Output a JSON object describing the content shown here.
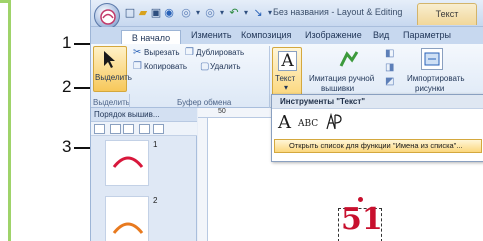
{
  "window": {
    "title": "Без названия - Layout & Editing",
    "context_tab": "Текст"
  },
  "tabs": [
    "В начало",
    "Изменить",
    "Композиция",
    "Изображение",
    "Вид",
    "Параметры"
  ],
  "clipboard": {
    "select_label": "Выделить",
    "cut": "Вырезать",
    "duplicate": "Дублировать",
    "copy": "Копировать",
    "delete": "Удалить",
    "group_select": "Выделить",
    "group_clipboard": "Буфер обмена"
  },
  "text_group": {
    "text_button": "Текст",
    "hand_embroidery": "Имитация ручной",
    "hand_embroidery_2": "вышивки",
    "import_patterns": "Импортировать",
    "import_patterns_2": "рисунки"
  },
  "menu": {
    "header": "Инструменты \"Текст\"",
    "tool_abc": "ABC",
    "item": "Открыть список для функции \"Имена из списка\"..."
  },
  "panel": {
    "title": "Порядок вышив...",
    "thumb1_num": "1",
    "thumb2_num": "2"
  },
  "ruler": {
    "mark": "50"
  },
  "canvas": {
    "big_text": "51"
  },
  "callouts": [
    "1",
    "2",
    "3"
  ],
  "colors": {
    "accent_green": "#9fd36a",
    "highlight": "#fbd77d",
    "big_text_red": "#c8102e"
  }
}
